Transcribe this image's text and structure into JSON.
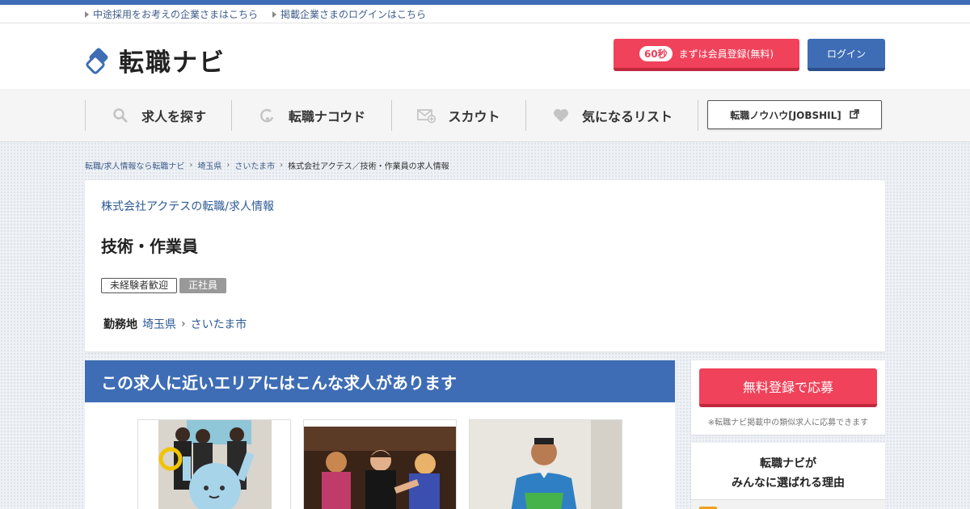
{
  "toplinks": {
    "corp_recruit": "中途採用をお考えの企業さまはこちら",
    "corp_login": "掲載企業さまのログインはこちら"
  },
  "brand": {
    "logo_text": "転職ナビ",
    "register_badge": "60秒",
    "register_label": "まずは会員登録(無料)",
    "login_label": "ログイン",
    "accent": "#3e6db5",
    "cta": "#f0425a"
  },
  "gnav": {
    "items": [
      {
        "label": "求人を探す",
        "icon": "search-icon"
      },
      {
        "label": "転職ナコウド",
        "icon": "nakoudo-icon"
      },
      {
        "label": "スカウト",
        "icon": "mail-plus-icon"
      },
      {
        "label": "気になるリスト",
        "icon": "heart-icon"
      }
    ],
    "jobshil_label": "転職ノウハウ[JOBSHIL]",
    "jobshil_icon": "external-link-icon"
  },
  "breadcrumb": {
    "items": [
      "転職/求人情報なら転職ナビ",
      "埼玉県",
      "さいたま市"
    ],
    "current": "株式会社アクテス／技術・作業員の求人情報"
  },
  "job": {
    "company_link": "株式会社アクテスの転職/求人情報",
    "title": "技術・作業員",
    "tags": [
      "未経験者歓迎",
      "正社員"
    ],
    "location_label": "勤務地",
    "prefecture": "埼玉県",
    "city": "さいたま市"
  },
  "nearby": {
    "heading": "この求人に近いエリアにはこんな求人があります"
  },
  "side": {
    "apply_label": "無料登録で応募",
    "apply_note": "※転職ナビ掲載中の類似求人に応募できます",
    "reason_line1": "転職ナビが",
    "reason_line2": "みんなに選ばれる理由"
  }
}
